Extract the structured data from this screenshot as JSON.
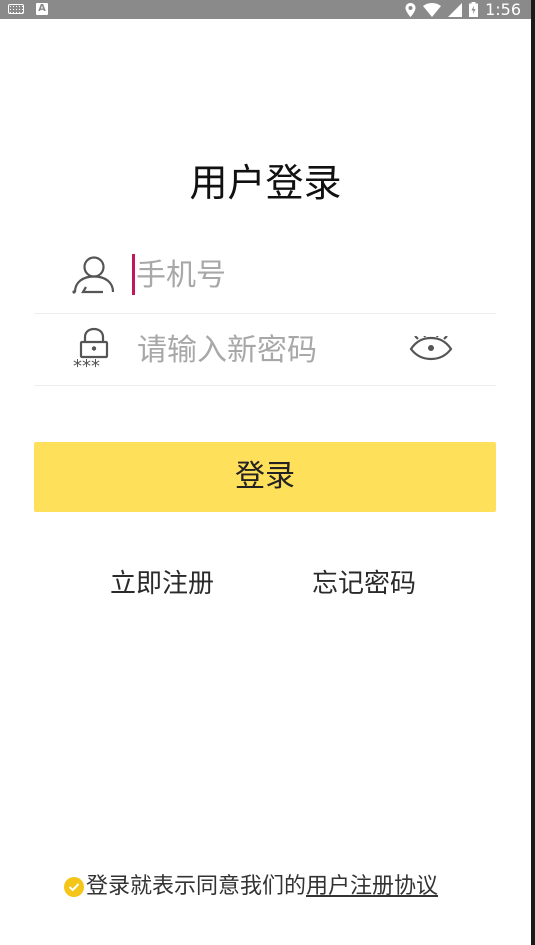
{
  "status_bar": {
    "time": "1:56",
    "left_icons": [
      "keyboard-icon",
      "a-icon"
    ],
    "right_icons": [
      "location-icon",
      "wifi-icon",
      "signal-icon",
      "battery-icon"
    ],
    "background_color": "#8a8a8a"
  },
  "page": {
    "title": "用户登录"
  },
  "form": {
    "phone": {
      "placeholder": "手机号",
      "value": "",
      "icon": "user-icon"
    },
    "password": {
      "placeholder": "请输入新密码",
      "value": "",
      "icon": "lock-icon",
      "toggle_icon": "eye-icon"
    },
    "login_label": "登录"
  },
  "links": {
    "register": "立即注册",
    "forgot": "忘记密码"
  },
  "agreement": {
    "prefix": "登录就表示同意我们的",
    "link_text": "用户注册协议",
    "icon": "check-circle-icon"
  },
  "colors": {
    "accent": "#ffe05b",
    "caret": "#c2185b",
    "check": "#f5c518"
  }
}
